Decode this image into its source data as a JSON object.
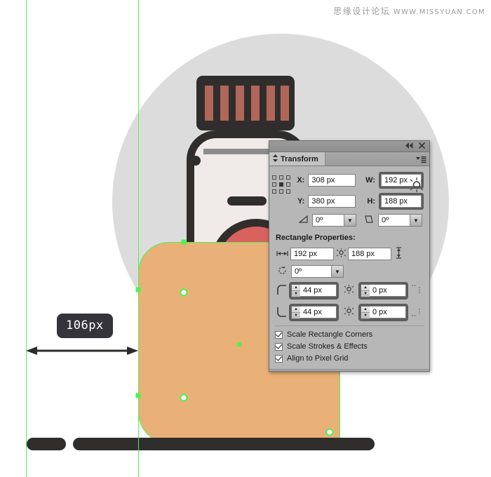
{
  "watermark": {
    "chinese": "思缘设计论坛",
    "url": "WWW.MISSYUAN.COM"
  },
  "canvas": {
    "colors": {
      "background": "#ffffff",
      "guide_green": "#4df252",
      "bg_circle_gray": "#dcdcdc",
      "dark_outline": "#302e2c",
      "bottle_body": "#f0ebe9",
      "cap_stripe": "#b1665a",
      "label_red": "#d9615e",
      "selected_rect_orange": "#e9b178",
      "neck_line_gray": "#8c8c8c"
    },
    "guides": {
      "left_x": "37",
      "right_x": "197"
    },
    "measurement": {
      "label": "106px",
      "arrow_type": "double-headed-horizontal"
    }
  },
  "panel": {
    "dock": {
      "collapse_icon": "◀◀",
      "close_icon": "✕"
    },
    "tab": {
      "title": "Transform",
      "tab_arrows_icon": "⇕",
      "menu_icon": "▾☰"
    },
    "reference_point": {
      "name": "reference-point-grid",
      "selected": "center"
    },
    "transform": {
      "x_label": "X:",
      "x_value": "308 px",
      "y_label": "Y:",
      "y_value": "380 px",
      "w_label": "W:",
      "w_value": "192 px",
      "h_label": "H:",
      "h_value": "188 px",
      "rotate_label": "⊿:",
      "rotate_value": "0º",
      "shear_label": "⊿:",
      "shear_value": "0º",
      "constrain_wh": "broken-link"
    },
    "rectangle_properties": {
      "section_title": "Rectangle Properties:",
      "width_value": "192 px",
      "height_value": "188 px",
      "width_icon": "|↔|",
      "height_icon": "↕",
      "rotation_value": "0º",
      "rotation_icon": "↻",
      "constrain_icon": "broken-link",
      "corners": [
        {
          "position": "top-left",
          "icon": "corner-round-tl-icon",
          "value": "44 px"
        },
        {
          "position": "top-right",
          "icon": "corner-square-tr-icon",
          "value": "0 px"
        },
        {
          "position": "bottom-left",
          "icon": "corner-round-bl-icon",
          "value": "44 px"
        },
        {
          "position": "bottom-right",
          "icon": "corner-square-br-icon",
          "value": "0 px"
        }
      ]
    },
    "checkboxes": [
      {
        "label": "Scale Rectangle Corners",
        "checked": true
      },
      {
        "label": "Scale Strokes & Effects",
        "checked": true
      },
      {
        "label": "Align to Pixel Grid",
        "checked": true
      }
    ]
  }
}
